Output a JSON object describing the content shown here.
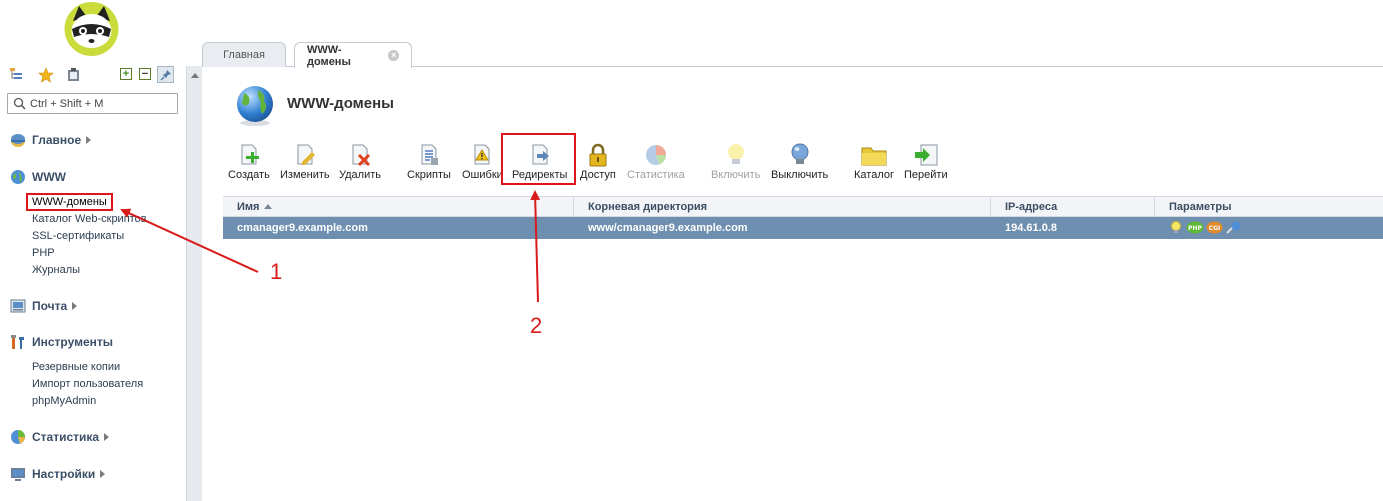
{
  "sidebar": {
    "search_placeholder": "Ctrl + Shift + M",
    "sections": {
      "main": "Главное",
      "www": "WWW",
      "mail": "Почта",
      "tools": "Инструменты",
      "stats": "Статистика",
      "settings": "Настройки"
    },
    "www_items": [
      "WWW-домены",
      "Каталог Web-скриптов",
      "SSL-сертификаты",
      "PHP",
      "Журналы"
    ],
    "tools_items": [
      "Резервные копии",
      "Импорт пользователя",
      "phpMyAdmin"
    ]
  },
  "tabs": [
    "Главная",
    "WWW-домены"
  ],
  "page": {
    "title": "WWW-домены"
  },
  "toolbar": {
    "create": "Создать",
    "edit": "Изменить",
    "delete": "Удалить",
    "scripts": "Скрипты",
    "errors": "Ошибки",
    "redirects": "Редиректы",
    "access": "Доступ",
    "statistics": "Статистика",
    "enable": "Включить",
    "disable": "Выключить",
    "catalog": "Каталог",
    "goto": "Перейти"
  },
  "table": {
    "columns": [
      "Имя",
      "Корневая директория",
      "IP-адреса",
      "Параметры"
    ],
    "rows": [
      {
        "name": "cmanager9.example.com",
        "root": "www/cmanager9.example.com",
        "ip": "194.61.0.8",
        "params": [
          "bulb-icon",
          "php-icon",
          "cgi-icon",
          "ssl-icon"
        ]
      }
    ]
  },
  "annotations": {
    "label1": "1",
    "label2": "2"
  },
  "colors": {
    "highlight": "#e0141b",
    "row_selected": "#6e8faf",
    "section_title": "#3b4f67"
  }
}
